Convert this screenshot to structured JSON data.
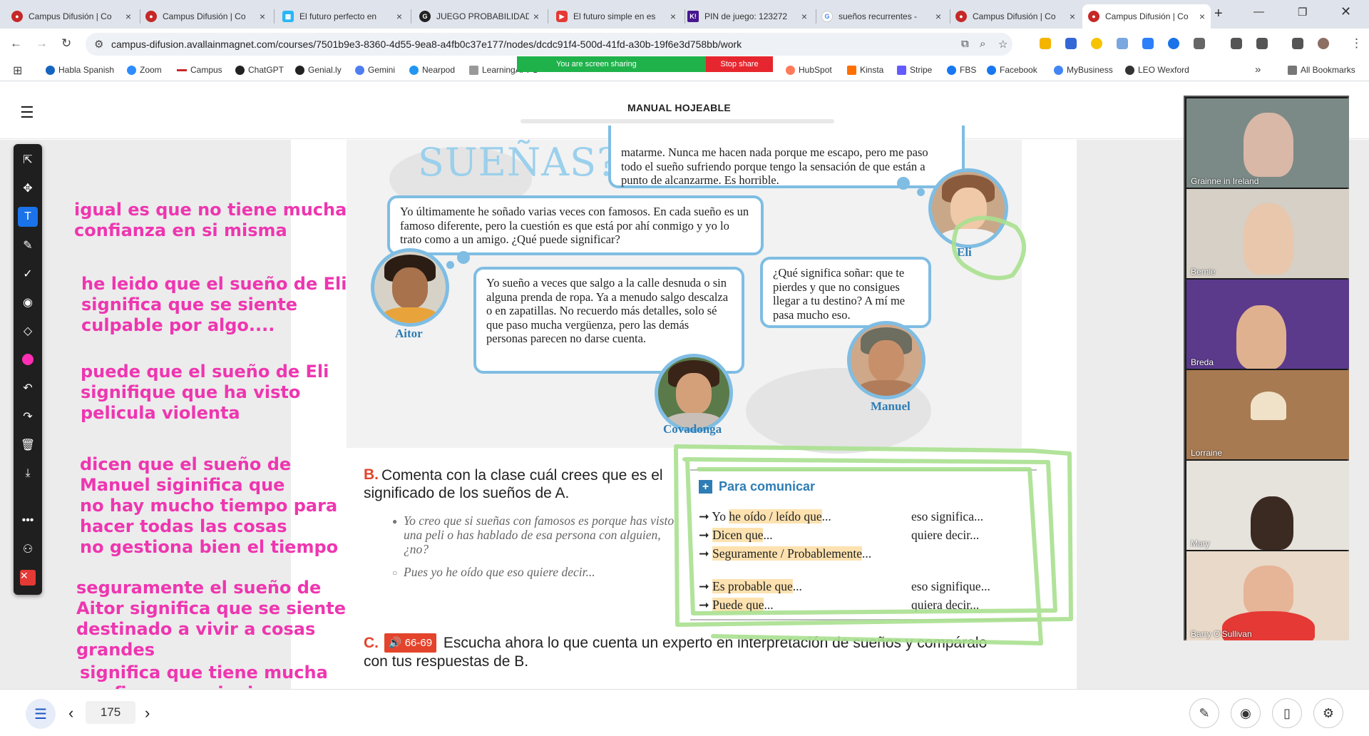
{
  "browser": {
    "tabs": [
      {
        "label": "Campus Difusión | Co",
        "icon": "campus-icon",
        "color": "#c62828"
      },
      {
        "label": "Campus Difusión | Co",
        "icon": "campus-icon",
        "color": "#c62828"
      },
      {
        "label": "El futuro perfecto en",
        "icon": "grid-icon",
        "color": "#29b6f6"
      },
      {
        "label": "JUEGO PROBABILIDAD",
        "icon": "genially-icon",
        "color": "#222222"
      },
      {
        "label": "El futuro simple en es",
        "icon": "youtube-icon",
        "color": "#e53935"
      },
      {
        "label": "PIN de juego: 123272",
        "icon": "kahoot-icon",
        "color": "#46178f"
      },
      {
        "label": "sueños recurrentes - ",
        "icon": "google-icon",
        "color": "#4285f4"
      },
      {
        "label": "Campus Difusión | Co",
        "icon": "campus-icon",
        "color": "#c62828"
      },
      {
        "label": "Campus Difusión | Co",
        "icon": "campus-icon",
        "color": "#c62828",
        "active": true
      }
    ],
    "url": "campus-difusion.avallainmagnet.com/courses/7501b9e3-8360-4d55-9ea8-a4fb0c37e177/nodes/dcdc91f4-500d-41fd-a30b-19f6e3d758bb/work",
    "bookmarks": [
      "Habla Spanish",
      "Zoom",
      "Campus",
      "ChatGPT",
      "Genial.ly",
      "Gemini",
      "Nearpod",
      "LearningAPPS",
      "HubSpot",
      "Kinsta",
      "Stripe",
      "FBS",
      "Facebook",
      "MyBusiness",
      "LEO Wexford"
    ],
    "all_bookmarks": "All Bookmarks",
    "screen_sharing": "You are screen sharing",
    "stop_share": "Stop share"
  },
  "app": {
    "title": "MANUAL HOJEABLE",
    "page_number": "175"
  },
  "page": {
    "heading_fragment": "SUEÑAS?",
    "bubbles": {
      "top_right": "matarme. Nunca me hacen nada porque me escapo, pero me paso todo el sueño sufriendo porque tengo la sensación de que están a punto de alcanzarme. Es horrible.",
      "famosos": "Yo últimamente he soñado varias veces con famosos. En cada sueño es un famoso diferente, pero la cuestión es que está por ahí conmigo y yo lo trato como a un amigo. ¿Qué puede significar?",
      "calle": "Yo sueño a veces que salgo a la calle desnuda o sin alguna prenda de ropa. Ya a menudo salgo descalza o en zapatillas. No recuerdo más detalles, solo sé que paso mucha vergüenza, pero las demás personas parecen no darse cuenta.",
      "destino": "¿Qué significa soñar: que te pierdes y que no consigues llegar a tu destino? A mí me pasa mucho eso."
    },
    "people": [
      "Eli",
      "Aitor",
      "Covadonga",
      "Manuel"
    ],
    "section_b": {
      "letter": "B.",
      "text": "Comenta con la clase cuál crees que es el significado de los sueños de A.",
      "example1": "Yo creo que si sueñas con famosos es porque has visto una peli o has hablado de esa persona con alguien, ¿no?",
      "example2": "Pues yo he oído que eso quiere decir..."
    },
    "para_comunicar": {
      "title": "Para comunicar",
      "rows_left": [
        {
          "prefix": "➞ Yo ",
          "highlight": "he oído / leído que",
          "suffix": "..."
        },
        {
          "prefix": "➞ ",
          "highlight": "Dicen que",
          "suffix": "..."
        },
        {
          "prefix": "➞ ",
          "highlight": "Seguramente / Probablemente",
          "suffix": "..."
        },
        {
          "prefix": "➞ ",
          "highlight": "Es probable que",
          "suffix": "..."
        },
        {
          "prefix": "➞ ",
          "highlight": "Puede que",
          "suffix": "..."
        }
      ],
      "rows_right": [
        "eso significa...",
        "quiere decir...",
        "eso signifique...",
        "quiera decir..."
      ]
    },
    "section_c": {
      "letter": "C.",
      "audio": "66-69",
      "text": "Escucha ahora lo que cuenta un experto en interpretación de sueños y compáralo con tus respuestas de B."
    }
  },
  "annotations": [
    "igual es que no tiene mucha\nconfianza en si misma",
    "he leido que el sueño de Eli\nsignifica que se siente\nculpable por algo....",
    "puede que el sueño de Eli\nsignifique que ha visto\npelicula violenta",
    "dicen que el sueño de\nManuel siginifica que\nno hay mucho tiempo para\nhacer todas las cosas\nno gestiona bien el tiempo",
    "seguramente el sueño de\nAitor significa que se siente\ndestinado a vivir a cosas\ngrandes",
    "significa que tiene mucha\nconfianza en si mismo"
  ],
  "annotation_color": "#ee36b0",
  "highlight_color": "#a9e08f",
  "participants": [
    "Grainne in Ireland",
    "Bernie",
    "Breda",
    "Lorraine",
    "Mary",
    "Barry O'Sullivan"
  ]
}
